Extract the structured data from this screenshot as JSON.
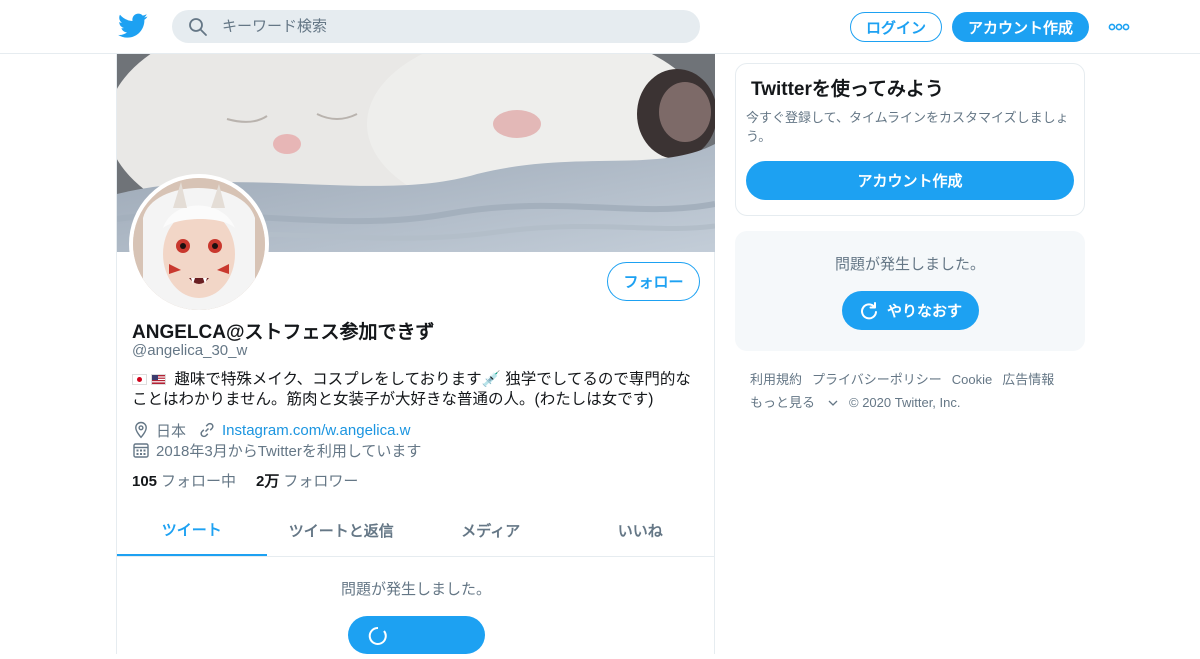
{
  "header": {
    "search_placeholder": "キーワード検索",
    "login_label": "ログイン",
    "signup_label": "アカウント作成"
  },
  "profile": {
    "follow_label": "フォロー",
    "name": "ANGELCA@ストフェス参加できず",
    "handle": "@angelica_30_w",
    "bio": "趣味で特殊メイク、コスプレをしております💉 独学でしてるので専門的なことはわかりません。筋肉と女装子が大好きな普通の人。(わたしは女です)",
    "location": "日本",
    "website": "Instagram.com/w.angelica.w",
    "joined": "2018年3月からTwitterを利用しています",
    "following_count": "105",
    "following_label": "フォロー中",
    "followers_count": "2万",
    "followers_label": "フォロワー"
  },
  "tabs": [
    {
      "label": "ツイート"
    },
    {
      "label": "ツイートと返信"
    },
    {
      "label": "メディア"
    },
    {
      "label": "いいね"
    }
  ],
  "main": {
    "error_text": "問題が発生しました。"
  },
  "signup_card": {
    "title": "Twitterを使ってみよう",
    "description": "今すぐ登録して、タイムラインをカスタマイズしましょう。",
    "button_label": "アカウント作成"
  },
  "error_card": {
    "text": "問題が発生しました。",
    "retry_label": "やりなおす"
  },
  "footer": {
    "links": [
      "利用規約",
      "プライバシーポリシー",
      "Cookie",
      "広告情報",
      "もっと見る"
    ],
    "copyright": "© 2020 Twitter, Inc."
  },
  "colors": {
    "accent": "#1da1f2",
    "secondary_text": "#657786",
    "border": "#e6ecf0"
  }
}
